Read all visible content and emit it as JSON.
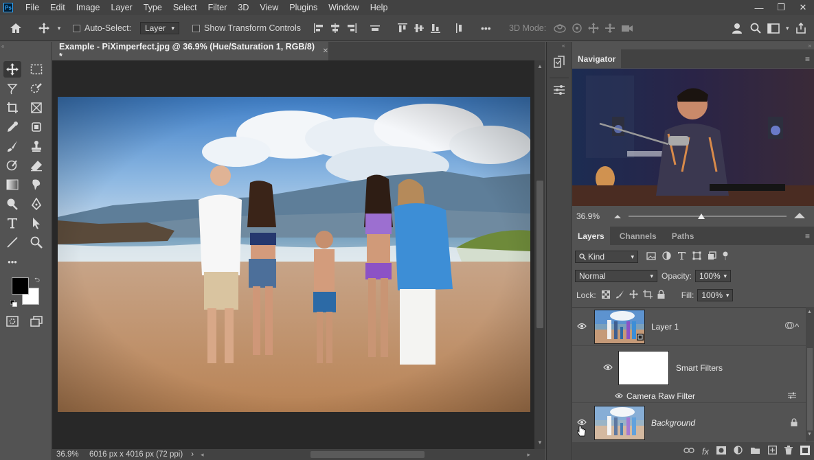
{
  "app": {
    "logo": "Ps"
  },
  "menu": [
    "File",
    "Edit",
    "Image",
    "Layer",
    "Type",
    "Select",
    "Filter",
    "3D",
    "View",
    "Plugins",
    "Window",
    "Help"
  ],
  "window_controls": {
    "minimize": "—",
    "restore": "❐",
    "close": "✕"
  },
  "options_bar": {
    "auto_select_label": "Auto-Select:",
    "auto_select_target": "Layer",
    "show_transform_label": "Show Transform Controls",
    "more": "•••",
    "mode_3d_label": "3D Mode:"
  },
  "document": {
    "tab_title": "Example - PiXimperfect.jpg @ 36.9% (Hue/Saturation 1, RGB/8) *",
    "tab_close": "✕"
  },
  "status_bar": {
    "zoom": "36.9%",
    "info": "6016 px x 4016 px (72 ppi)",
    "arrow": "›"
  },
  "navigator": {
    "tab": "Navigator",
    "zoom": "36.9%",
    "zoom_slider_value": 0.46
  },
  "layers_panel": {
    "tabs": [
      "Layers",
      "Channels",
      "Paths"
    ],
    "filter_kind": "Kind",
    "blend_mode": "Normal",
    "opacity_label": "Opacity:",
    "opacity_value": "100%",
    "lock_label": "Lock:",
    "fill_label": "Fill:",
    "fill_value": "100%",
    "layers": [
      {
        "name": "Layer 1"
      },
      {
        "name": "Smart Filters"
      },
      {
        "name": "Camera Raw Filter"
      },
      {
        "name": "Background"
      }
    ]
  },
  "colors": {
    "foreground": "#000000",
    "background": "#ffffff",
    "accent": "#31a8ff"
  }
}
